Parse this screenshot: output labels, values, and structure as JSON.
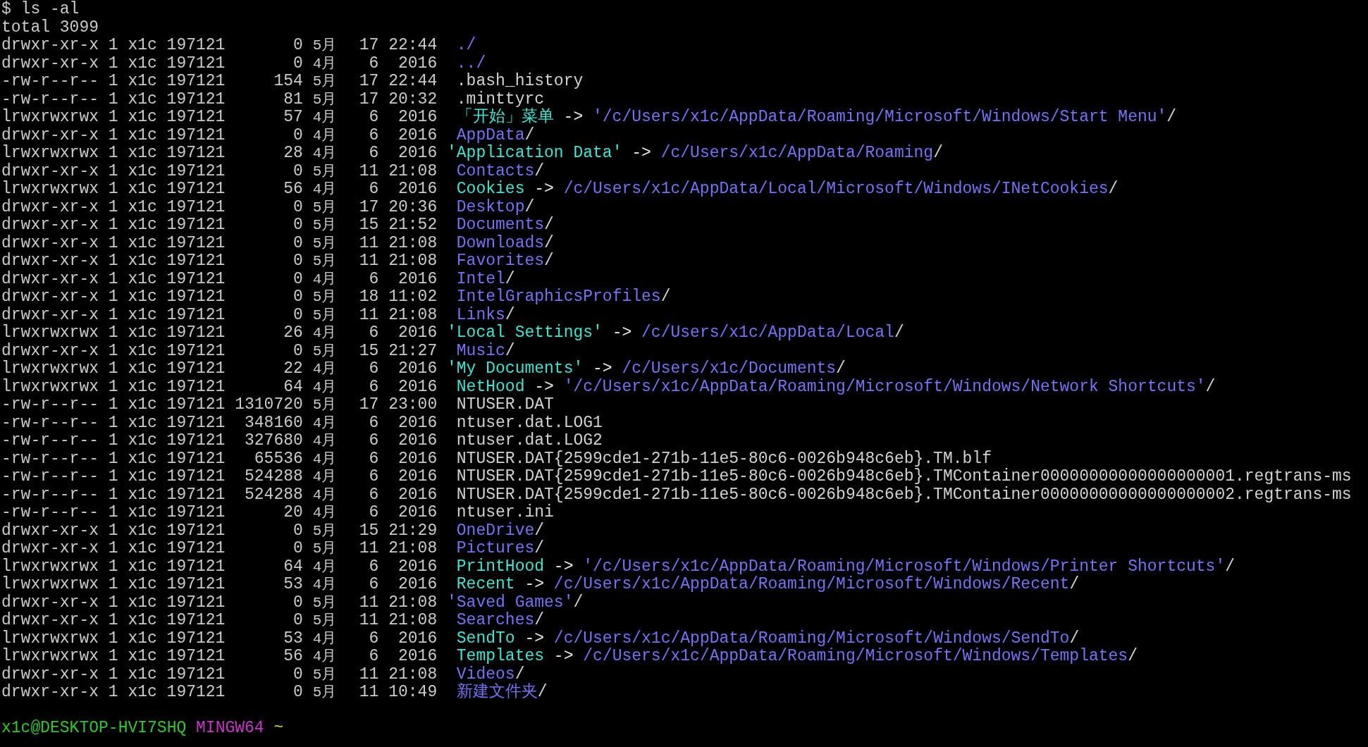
{
  "terminal": {
    "command": {
      "prompt": "$",
      "text": "ls -al"
    },
    "total": "total 3099",
    "entries": [
      {
        "perms": "drwxr-xr-x",
        "links": "1",
        "owner": "x1c",
        "group": "197121",
        "size": "0",
        "month": "5月",
        "day": "17",
        "time": "22:44",
        "name": "./",
        "kind": "dir",
        "quoted": false
      },
      {
        "perms": "drwxr-xr-x",
        "links": "1",
        "owner": "x1c",
        "group": "197121",
        "size": "0",
        "month": "4月",
        "day": "6",
        "time": "2016",
        "name": "../",
        "kind": "dir",
        "quoted": false
      },
      {
        "perms": "-rw-r--r--",
        "links": "1",
        "owner": "x1c",
        "group": "197121",
        "size": "154",
        "month": "5月",
        "day": "17",
        "time": "22:44",
        "name": ".bash_history",
        "kind": "file",
        "quoted": false
      },
      {
        "perms": "-rw-r--r--",
        "links": "1",
        "owner": "x1c",
        "group": "197121",
        "size": "81",
        "month": "5月",
        "day": "17",
        "time": "20:32",
        "name": ".minttyrc",
        "kind": "file",
        "quoted": false
      },
      {
        "perms": "lrwxrwxrwx",
        "links": "1",
        "owner": "x1c",
        "group": "197121",
        "size": "57",
        "month": "4月",
        "day": "6",
        "time": "2016",
        "name": "「开始」菜单",
        "kind": "link",
        "quoted": false,
        "arrow": "->",
        "target": "'/c/Users/x1c/AppData/Roaming/Microsoft/Windows/Start Menu'",
        "suffix": "/"
      },
      {
        "perms": "drwxr-xr-x",
        "links": "1",
        "owner": "x1c",
        "group": "197121",
        "size": "0",
        "month": "4月",
        "day": "6",
        "time": "2016",
        "name": "AppData",
        "kind": "dir",
        "quoted": false,
        "suffix": "/"
      },
      {
        "perms": "lrwxrwxrwx",
        "links": "1",
        "owner": "x1c",
        "group": "197121",
        "size": "28",
        "month": "4月",
        "day": "6",
        "time": "2016",
        "name": "'Application Data'",
        "kind": "link",
        "quoted": true,
        "arrow": "->",
        "target": "/c/Users/x1c/AppData/Roaming",
        "suffix": "/"
      },
      {
        "perms": "drwxr-xr-x",
        "links": "1",
        "owner": "x1c",
        "group": "197121",
        "size": "0",
        "month": "5月",
        "day": "11",
        "time": "21:08",
        "name": "Contacts",
        "kind": "dir",
        "quoted": false,
        "suffix": "/"
      },
      {
        "perms": "lrwxrwxrwx",
        "links": "1",
        "owner": "x1c",
        "group": "197121",
        "size": "56",
        "month": "4月",
        "day": "6",
        "time": "2016",
        "name": "Cookies",
        "kind": "link",
        "quoted": false,
        "arrow": "->",
        "target": "/c/Users/x1c/AppData/Local/Microsoft/Windows/INetCookies",
        "suffix": "/"
      },
      {
        "perms": "drwxr-xr-x",
        "links": "1",
        "owner": "x1c",
        "group": "197121",
        "size": "0",
        "month": "5月",
        "day": "17",
        "time": "20:36",
        "name": "Desktop",
        "kind": "dir",
        "quoted": false,
        "suffix": "/"
      },
      {
        "perms": "drwxr-xr-x",
        "links": "1",
        "owner": "x1c",
        "group": "197121",
        "size": "0",
        "month": "5月",
        "day": "15",
        "time": "21:52",
        "name": "Documents",
        "kind": "dir",
        "quoted": false,
        "suffix": "/"
      },
      {
        "perms": "drwxr-xr-x",
        "links": "1",
        "owner": "x1c",
        "group": "197121",
        "size": "0",
        "month": "5月",
        "day": "11",
        "time": "21:08",
        "name": "Downloads",
        "kind": "dir",
        "quoted": false,
        "suffix": "/"
      },
      {
        "perms": "drwxr-xr-x",
        "links": "1",
        "owner": "x1c",
        "group": "197121",
        "size": "0",
        "month": "5月",
        "day": "11",
        "time": "21:08",
        "name": "Favorites",
        "kind": "dir",
        "quoted": false,
        "suffix": "/"
      },
      {
        "perms": "drwxr-xr-x",
        "links": "1",
        "owner": "x1c",
        "group": "197121",
        "size": "0",
        "month": "4月",
        "day": "6",
        "time": "2016",
        "name": "Intel",
        "kind": "dir",
        "quoted": false,
        "suffix": "/"
      },
      {
        "perms": "drwxr-xr-x",
        "links": "1",
        "owner": "x1c",
        "group": "197121",
        "size": "0",
        "month": "5月",
        "day": "18",
        "time": "11:02",
        "name": "IntelGraphicsProfiles",
        "kind": "dir",
        "quoted": false,
        "suffix": "/"
      },
      {
        "perms": "drwxr-xr-x",
        "links": "1",
        "owner": "x1c",
        "group": "197121",
        "size": "0",
        "month": "5月",
        "day": "11",
        "time": "21:08",
        "name": "Links",
        "kind": "dir",
        "quoted": false,
        "suffix": "/"
      },
      {
        "perms": "lrwxrwxrwx",
        "links": "1",
        "owner": "x1c",
        "group": "197121",
        "size": "26",
        "month": "4月",
        "day": "6",
        "time": "2016",
        "name": "'Local Settings'",
        "kind": "link",
        "quoted": true,
        "arrow": "->",
        "target": "/c/Users/x1c/AppData/Local",
        "suffix": "/"
      },
      {
        "perms": "drwxr-xr-x",
        "links": "1",
        "owner": "x1c",
        "group": "197121",
        "size": "0",
        "month": "5月",
        "day": "15",
        "time": "21:27",
        "name": "Music",
        "kind": "dir",
        "quoted": false,
        "suffix": "/"
      },
      {
        "perms": "lrwxrwxrwx",
        "links": "1",
        "owner": "x1c",
        "group": "197121",
        "size": "22",
        "month": "4月",
        "day": "6",
        "time": "2016",
        "name": "'My Documents'",
        "kind": "link",
        "quoted": true,
        "arrow": "->",
        "target": "/c/Users/x1c/Documents",
        "suffix": "/"
      },
      {
        "perms": "lrwxrwxrwx",
        "links": "1",
        "owner": "x1c",
        "group": "197121",
        "size": "64",
        "month": "4月",
        "day": "6",
        "time": "2016",
        "name": "NetHood",
        "kind": "link",
        "quoted": false,
        "arrow": "->",
        "target": "'/c/Users/x1c/AppData/Roaming/Microsoft/Windows/Network Shortcuts'",
        "suffix": "/"
      },
      {
        "perms": "-rw-r--r--",
        "links": "1",
        "owner": "x1c",
        "group": "197121",
        "size": "1310720",
        "month": "5月",
        "day": "17",
        "time": "23:00",
        "name": "NTUSER.DAT",
        "kind": "file",
        "quoted": false
      },
      {
        "perms": "-rw-r--r--",
        "links": "1",
        "owner": "x1c",
        "group": "197121",
        "size": "348160",
        "month": "4月",
        "day": "6",
        "time": "2016",
        "name": "ntuser.dat.LOG1",
        "kind": "file",
        "quoted": false
      },
      {
        "perms": "-rw-r--r--",
        "links": "1",
        "owner": "x1c",
        "group": "197121",
        "size": "327680",
        "month": "4月",
        "day": "6",
        "time": "2016",
        "name": "ntuser.dat.LOG2",
        "kind": "file",
        "quoted": false
      },
      {
        "perms": "-rw-r--r--",
        "links": "1",
        "owner": "x1c",
        "group": "197121",
        "size": "65536",
        "month": "4月",
        "day": "6",
        "time": "2016",
        "name": "NTUSER.DAT{2599cde1-271b-11e5-80c6-0026b948c6eb}.TM.blf",
        "kind": "file",
        "quoted": false
      },
      {
        "perms": "-rw-r--r--",
        "links": "1",
        "owner": "x1c",
        "group": "197121",
        "size": "524288",
        "month": "4月",
        "day": "6",
        "time": "2016",
        "name": "NTUSER.DAT{2599cde1-271b-11e5-80c6-0026b948c6eb}.TMContainer00000000000000000001.regtrans-ms",
        "kind": "file",
        "quoted": false
      },
      {
        "perms": "-rw-r--r--",
        "links": "1",
        "owner": "x1c",
        "group": "197121",
        "size": "524288",
        "month": "4月",
        "day": "6",
        "time": "2016",
        "name": "NTUSER.DAT{2599cde1-271b-11e5-80c6-0026b948c6eb}.TMContainer00000000000000000002.regtrans-ms",
        "kind": "file",
        "quoted": false
      },
      {
        "perms": "-rw-r--r--",
        "links": "1",
        "owner": "x1c",
        "group": "197121",
        "size": "20",
        "month": "4月",
        "day": "6",
        "time": "2016",
        "name": "ntuser.ini",
        "kind": "file",
        "quoted": false
      },
      {
        "perms": "drwxr-xr-x",
        "links": "1",
        "owner": "x1c",
        "group": "197121",
        "size": "0",
        "month": "5月",
        "day": "15",
        "time": "21:29",
        "name": "OneDrive",
        "kind": "dir",
        "quoted": false,
        "suffix": "/"
      },
      {
        "perms": "drwxr-xr-x",
        "links": "1",
        "owner": "x1c",
        "group": "197121",
        "size": "0",
        "month": "5月",
        "day": "11",
        "time": "21:08",
        "name": "Pictures",
        "kind": "dir",
        "quoted": false,
        "suffix": "/"
      },
      {
        "perms": "lrwxrwxrwx",
        "links": "1",
        "owner": "x1c",
        "group": "197121",
        "size": "64",
        "month": "4月",
        "day": "6",
        "time": "2016",
        "name": "PrintHood",
        "kind": "link",
        "quoted": false,
        "arrow": "->",
        "target": "'/c/Users/x1c/AppData/Roaming/Microsoft/Windows/Printer Shortcuts'",
        "suffix": "/"
      },
      {
        "perms": "lrwxrwxrwx",
        "links": "1",
        "owner": "x1c",
        "group": "197121",
        "size": "53",
        "month": "4月",
        "day": "6",
        "time": "2016",
        "name": "Recent",
        "kind": "link",
        "quoted": false,
        "arrow": "->",
        "target": "/c/Users/x1c/AppData/Roaming/Microsoft/Windows/Recent",
        "suffix": "/"
      },
      {
        "perms": "drwxr-xr-x",
        "links": "1",
        "owner": "x1c",
        "group": "197121",
        "size": "0",
        "month": "5月",
        "day": "11",
        "time": "21:08",
        "name": "'Saved Games'",
        "kind": "dir",
        "quoted": true,
        "suffix": "/"
      },
      {
        "perms": "drwxr-xr-x",
        "links": "1",
        "owner": "x1c",
        "group": "197121",
        "size": "0",
        "month": "5月",
        "day": "11",
        "time": "21:08",
        "name": "Searches",
        "kind": "dir",
        "quoted": false,
        "suffix": "/"
      },
      {
        "perms": "lrwxrwxrwx",
        "links": "1",
        "owner": "x1c",
        "group": "197121",
        "size": "53",
        "month": "4月",
        "day": "6",
        "time": "2016",
        "name": "SendTo",
        "kind": "link",
        "quoted": false,
        "arrow": "->",
        "target": "/c/Users/x1c/AppData/Roaming/Microsoft/Windows/SendTo",
        "suffix": "/"
      },
      {
        "perms": "lrwxrwxrwx",
        "links": "1",
        "owner": "x1c",
        "group": "197121",
        "size": "56",
        "month": "4月",
        "day": "6",
        "time": "2016",
        "name": "Templates",
        "kind": "link",
        "quoted": false,
        "arrow": "->",
        "target": "/c/Users/x1c/AppData/Roaming/Microsoft/Windows/Templates",
        "suffix": "/"
      },
      {
        "perms": "drwxr-xr-x",
        "links": "1",
        "owner": "x1c",
        "group": "197121",
        "size": "0",
        "month": "5月",
        "day": "11",
        "time": "21:08",
        "name": "Videos",
        "kind": "dir",
        "quoted": false,
        "suffix": "/"
      },
      {
        "perms": "drwxr-xr-x",
        "links": "1",
        "owner": "x1c",
        "group": "197121",
        "size": "0",
        "month": "5月",
        "day": "11",
        "time": "10:49",
        "name": "新建文件夹",
        "kind": "dir",
        "quoted": false,
        "suffix": "/"
      }
    ],
    "prompt": {
      "user_host": "x1c@DESKTOP-HVI7SHQ",
      "system": "MINGW64",
      "cwd": "~"
    }
  }
}
